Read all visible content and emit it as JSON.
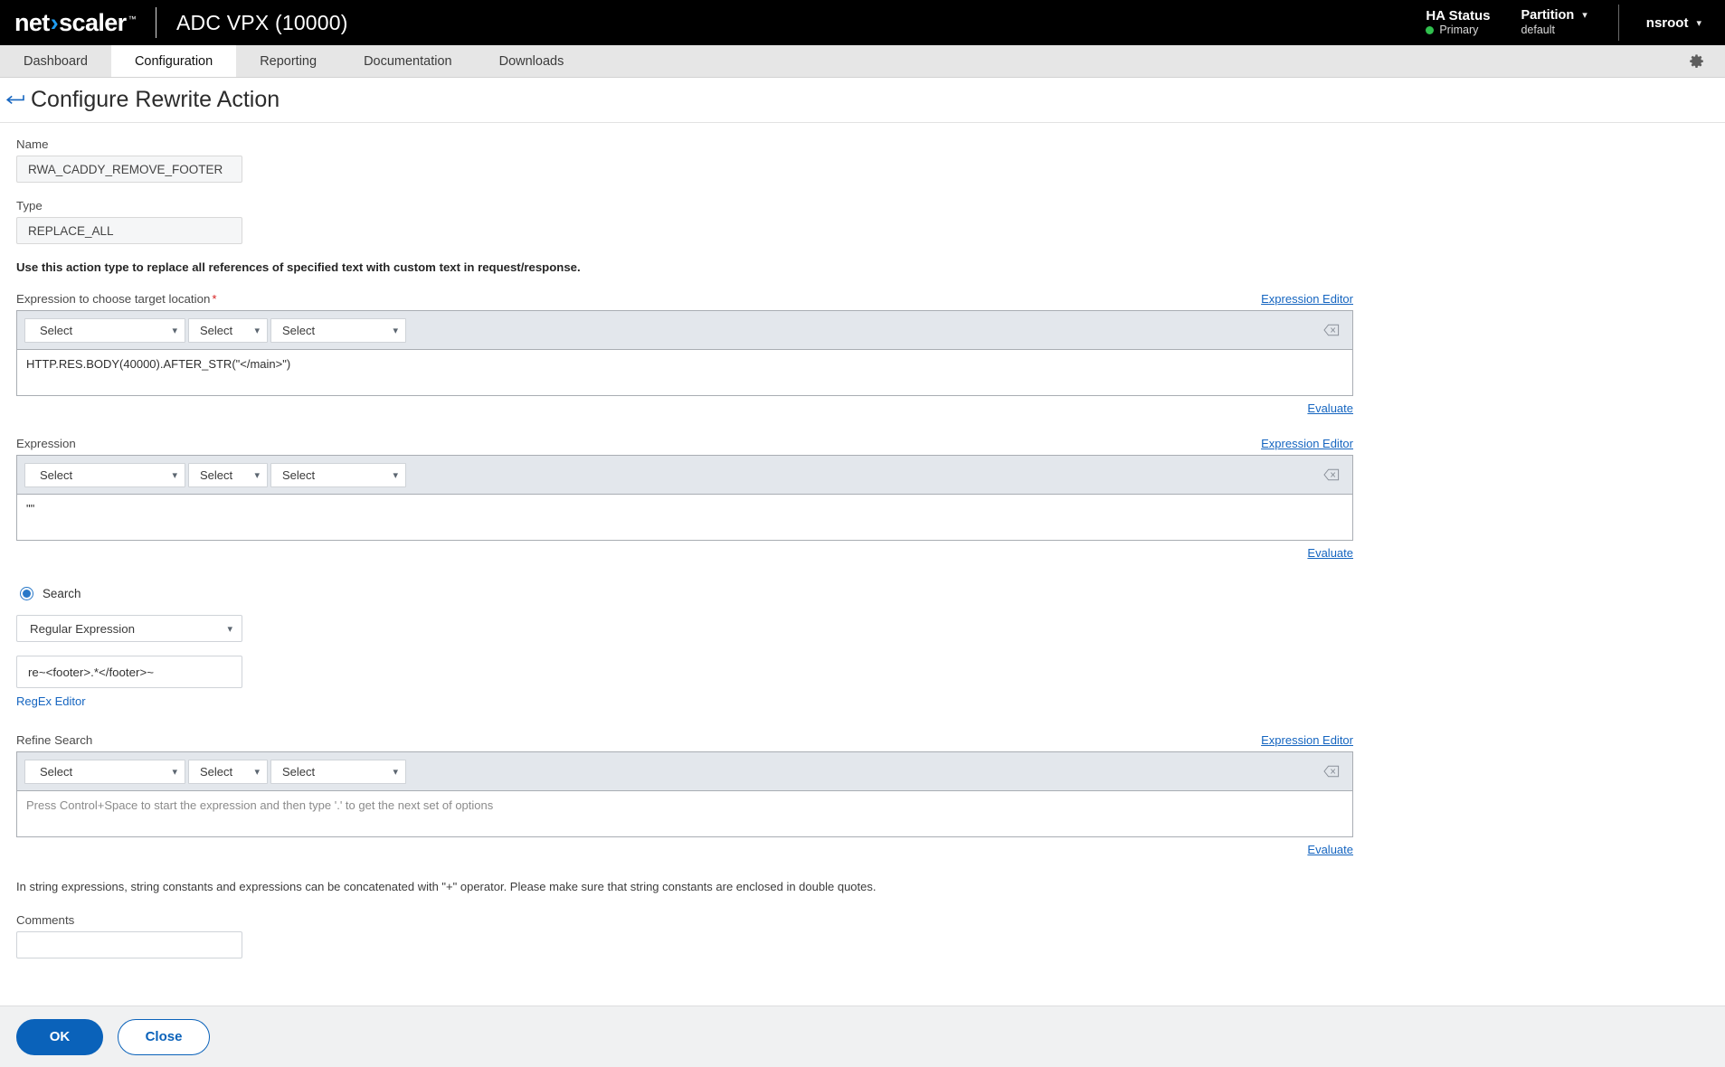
{
  "header": {
    "brand_net": "net",
    "brand_chevron": "›",
    "brand_scaler": "scaler",
    "brand_tm": "™",
    "product": "ADC VPX (10000)",
    "ha_status_title": "HA Status",
    "ha_status_value": "Primary",
    "partition_title": "Partition",
    "partition_value": "default",
    "user": "nsroot"
  },
  "tabs": [
    {
      "label": "Dashboard",
      "active": false
    },
    {
      "label": "Configuration",
      "active": true
    },
    {
      "label": "Reporting",
      "active": false
    },
    {
      "label": "Documentation",
      "active": false
    },
    {
      "label": "Downloads",
      "active": false
    }
  ],
  "settings_icon": "gear-icon",
  "page": {
    "back_icon": "back-arrow-icon",
    "title": "Configure Rewrite Action"
  },
  "form": {
    "name_label": "Name",
    "name_value": "RWA_CADDY_REMOVE_FOOTER",
    "type_label": "Type",
    "type_value": "REPLACE_ALL",
    "type_description": "Use this action type to replace all references of specified text with custom text in request/response."
  },
  "select_placeholder": "Select",
  "links": {
    "expression_editor": "Expression Editor",
    "evaluate": "Evaluate",
    "regex_editor": "RegEx Editor"
  },
  "target_expression": {
    "label": "Expression to choose target location",
    "required_marker": "*",
    "value": "HTTP.RES.BODY(40000).AFTER_STR(\"</main>\")"
  },
  "expression": {
    "label": "Expression",
    "value": "\"\""
  },
  "search": {
    "radio_label": "Search",
    "type_selected": "Regular Expression",
    "pattern_value": "re~<footer>.*</footer>~"
  },
  "refine_search": {
    "label": "Refine Search",
    "placeholder": "Press Control+Space to start the expression and then type '.' to get the next set of options",
    "value": ""
  },
  "note": "In string expressions, string constants and expressions can be concatenated with \"+\" operator. Please make sure that string constants are enclosed in double quotes.",
  "comments": {
    "label": "Comments",
    "value": ""
  },
  "footer": {
    "ok_label": "OK",
    "close_label": "Close"
  },
  "colors": {
    "accent": "#0a62ba",
    "link": "#1565c0",
    "status_green": "#31c04e",
    "brand_chevron": "#1f9cf0"
  }
}
